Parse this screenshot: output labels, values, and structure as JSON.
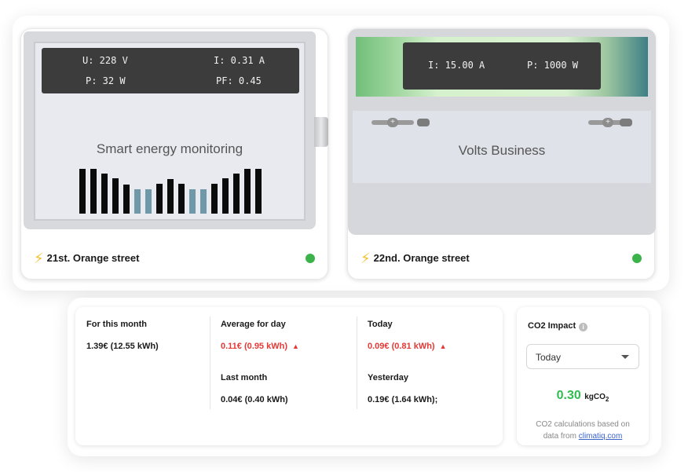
{
  "meters": [
    {
      "readings": {
        "u": "U: 228 V",
        "i": "I: 0.31 A",
        "p": "P: 32 W",
        "pf": "PF: 0.45"
      },
      "device_label": "Smart energy monitoring",
      "location": "21st. Orange street",
      "status_color": "#3bb34a",
      "bars": [
        {
          "level": 0.95,
          "highlight": false
        },
        {
          "level": 0.95,
          "highlight": false
        },
        {
          "level": 0.85,
          "highlight": false
        },
        {
          "level": 0.75,
          "highlight": false
        },
        {
          "level": 0.62,
          "highlight": false
        },
        {
          "level": 0.52,
          "highlight": true
        },
        {
          "level": 0.52,
          "highlight": true
        },
        {
          "level": 0.63,
          "highlight": false
        },
        {
          "level": 0.73,
          "highlight": false
        },
        {
          "level": 0.63,
          "highlight": false
        },
        {
          "level": 0.52,
          "highlight": true
        },
        {
          "level": 0.52,
          "highlight": true
        },
        {
          "level": 0.63,
          "highlight": false
        },
        {
          "level": 0.75,
          "highlight": false
        },
        {
          "level": 0.85,
          "highlight": false
        },
        {
          "level": 0.95,
          "highlight": false
        },
        {
          "level": 0.95,
          "highlight": false
        }
      ],
      "bar_color": "#0b0b0b",
      "bar_highlight_color": "#6f99a8"
    },
    {
      "readings": {
        "i": "I: 15.00 A",
        "p": "P: 1000 W"
      },
      "device_label": "Volts Business",
      "location": "22nd. Orange street",
      "status_color": "#3bb34a"
    }
  ],
  "stats": {
    "month": {
      "label": "For this month",
      "value": "1.39€ (12.55 kWh)"
    },
    "avg_day": {
      "label": "Average for day",
      "value": "0.11€ (0.95 kWh)"
    },
    "last_month": {
      "label": "Last month",
      "value": "0.04€ (0.40 kWh)"
    },
    "today": {
      "label": "Today",
      "value": "0.09€ (0.81 kWh)"
    },
    "yesterday": {
      "label": "Yesterday",
      "value": "0.19€ (1.64 kWh);"
    },
    "trend_color": "#e53935"
  },
  "co2": {
    "title": "CO2 Impact",
    "period": "Today",
    "value": "0.30",
    "unit_prefix": "kgCO",
    "unit_sub": "2",
    "note_line1": "CO2 calculations based on",
    "note_line2": "data from",
    "link_text": "climatiq.com",
    "value_color": "#2ebd4f"
  }
}
